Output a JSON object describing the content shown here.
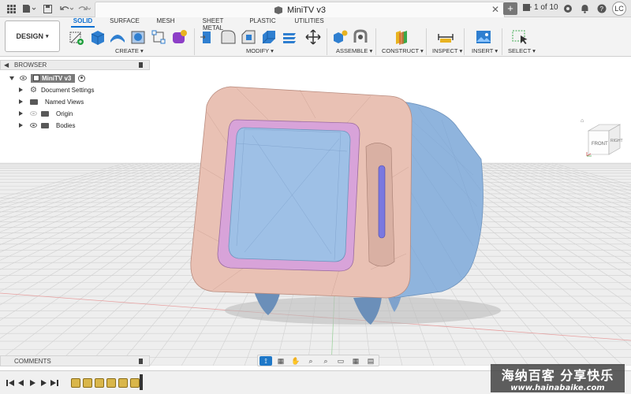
{
  "document": {
    "title": "MiniTV v3",
    "pager": "1 of 10",
    "user_initials": "LC"
  },
  "ribbon": {
    "workspace": "DESIGN",
    "tabs": [
      {
        "label": "SOLID",
        "active": true
      },
      {
        "label": "SURFACE",
        "active": false
      },
      {
        "label": "MESH",
        "active": false
      },
      {
        "label": "SHEET METAL",
        "active": false
      },
      {
        "label": "PLASTIC",
        "active": false
      },
      {
        "label": "UTILITIES",
        "active": false
      }
    ],
    "groups": [
      "CREATE",
      "MODIFY",
      "ASSEMBLE",
      "CONSTRUCT",
      "INSPECT",
      "INSERT",
      "SELECT"
    ]
  },
  "browser": {
    "title": "BROWSER",
    "root": "MiniTV v3",
    "items": [
      {
        "label": "Document Settings",
        "icon": "gear-icon"
      },
      {
        "label": "Named Views",
        "icon": "folder-icon"
      },
      {
        "label": "Origin",
        "icon": "folder-icon",
        "visible": false
      },
      {
        "label": "Bodies",
        "icon": "folder-icon",
        "visible": true
      }
    ]
  },
  "comments": {
    "title": "COMMENTS"
  },
  "viewcube": {
    "front": "FRONT",
    "right": "RIGHT"
  },
  "timeline": {
    "features": 6
  },
  "watermark": {
    "text": "海纳百客 分享快乐",
    "url": "www.hainabaike.com"
  },
  "colors": {
    "accent": "#0b6fd1",
    "model_shell": "#8fb4dd",
    "model_bezel": "#e9c1b4",
    "model_screen_trim": "#d8a3d9"
  }
}
